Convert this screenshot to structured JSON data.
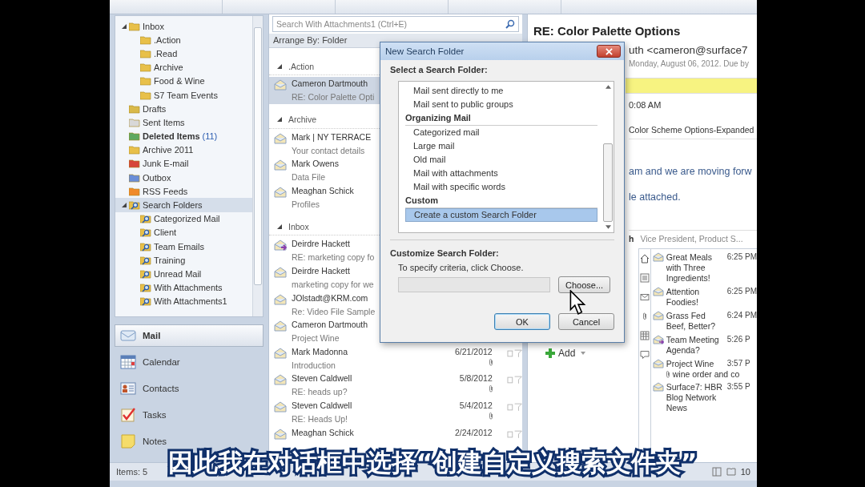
{
  "nav": {
    "folders": [
      {
        "label": "Inbox",
        "kind": "inbox",
        "selected": false,
        "expanded": true,
        "children": [
          {
            "label": ".Action",
            "kind": "folder",
            "selected": false
          },
          {
            "label": ".Read",
            "kind": "folder",
            "selected": false
          },
          {
            "label": "Archive",
            "kind": "folder",
            "selected": false
          },
          {
            "label": "Food & Wine",
            "kind": "folder",
            "selected": false
          },
          {
            "label": "S7 Team Events",
            "kind": "folder",
            "selected": false
          }
        ]
      },
      {
        "label": "Drafts",
        "kind": "drafts",
        "selected": false
      },
      {
        "label": "Sent Items",
        "kind": "sent",
        "selected": false
      },
      {
        "label": "Deleted Items",
        "count": "(11)",
        "kind": "deleted",
        "selected": false
      },
      {
        "label": "Archive 2011",
        "kind": "folder",
        "selected": false
      },
      {
        "label": "Junk E-mail",
        "kind": "junk",
        "selected": false
      },
      {
        "label": "Outbox",
        "kind": "outbox",
        "selected": false
      },
      {
        "label": "RSS Feeds",
        "kind": "rss",
        "selected": false
      },
      {
        "label": "Search Folders",
        "kind": "search",
        "selected": true,
        "expanded": true,
        "children": [
          {
            "label": "Categorized Mail",
            "kind": "search",
            "selected": false
          },
          {
            "label": "Client",
            "kind": "search",
            "selected": false
          },
          {
            "label": "Team Emails",
            "kind": "search",
            "selected": false
          },
          {
            "label": "Training",
            "kind": "search",
            "selected": false
          },
          {
            "label": "Unread Mail",
            "kind": "search",
            "selected": false
          },
          {
            "label": "With Attachments",
            "kind": "search",
            "selected": false
          },
          {
            "label": "With Attachments1",
            "kind": "search",
            "selected": false
          }
        ]
      }
    ],
    "buttons": [
      {
        "label": "Mail",
        "kind": "mail",
        "selected": true
      },
      {
        "label": "Calendar",
        "kind": "calendar",
        "selected": false
      },
      {
        "label": "Contacts",
        "kind": "contacts",
        "selected": false
      },
      {
        "label": "Tasks",
        "kind": "tasks",
        "selected": false
      },
      {
        "label": "Notes",
        "kind": "notes",
        "selected": false
      }
    ]
  },
  "list": {
    "search": {
      "placeholder": "Search With Attachments1 (Ctrl+E)"
    },
    "arrange": "Arrange By: Folder",
    "groups": [
      {
        "title": ".Action",
        "expanded": true,
        "messages": [
          {
            "sender": "Cameron Dartmouth",
            "subject": "RE: Color Palette Opti",
            "kind": "read",
            "selected": true
          }
        ]
      },
      {
        "title": "Archive",
        "expanded": true,
        "messages": [
          {
            "sender": "Mark | NY TERRACE",
            "subject": "Your contact details",
            "kind": "read",
            "selected": false
          },
          {
            "sender": "Mark Owens",
            "subject": "Data File",
            "kind": "read",
            "selected": false
          },
          {
            "sender": "Meaghan Schick",
            "subject": "Profiles",
            "kind": "read",
            "selected": false
          }
        ]
      },
      {
        "title": "Inbox",
        "expanded": true,
        "messages": [
          {
            "sender": "Deirdre Hackett",
            "subject": "RE: marketing copy fo",
            "kind": "forwarded",
            "selected": false
          },
          {
            "sender": "Deirdre Hackett",
            "subject": "marketing copy for we",
            "kind": "read",
            "selected": false
          },
          {
            "sender": "JOlstadt@KRM.com",
            "subject": "Re: Video File Sample",
            "kind": "read",
            "selected": false
          },
          {
            "sender": "Cameron Dartmouth",
            "subject": "Project Wine",
            "kind": "read",
            "selected": false
          },
          {
            "sender": "Mark Madonna",
            "subject": "Introduction",
            "date": "6/21/2012",
            "attachment": true,
            "kind": "read",
            "selected": false
          },
          {
            "sender": "Steven Caldwell",
            "subject": "RE: heads up?",
            "date": "5/8/2012",
            "attachment": true,
            "kind": "read",
            "selected": false
          },
          {
            "sender": "Steven Caldwell",
            "subject": "RE: Heads Up!",
            "date": "5/4/2012",
            "attachment": true,
            "kind": "read",
            "selected": false
          },
          {
            "sender": "Meaghan Schick",
            "date": "2/24/2012",
            "attachment": false,
            "kind": "read",
            "selected": false
          }
        ]
      }
    ]
  },
  "reading": {
    "title": "RE: Color Palette Options",
    "from": "uth <cameron@surface7",
    "sent": "Monday, August 06, 2012. Due by",
    "time": "0:08 AM",
    "attachment": "Color Scheme Options-Expanded",
    "body": [
      "am and we are moving forw",
      "le attached."
    ],
    "person": {
      "name": "h",
      "role": "Vice President, Product S..."
    },
    "add": "Add",
    "feed": [
      {
        "title": "Great Meals with Three Ingredients!",
        "time": "6:25 PM",
        "kind": "post"
      },
      {
        "title": "Attention Foodies!",
        "time": "6:25 PM",
        "kind": "post"
      },
      {
        "title": "Grass Fed Beef, Better?",
        "time": "6:24 PM",
        "kind": "post"
      },
      {
        "title": "Team Meeting Agenda?",
        "time": "5:26 P",
        "kind": "forwarded"
      },
      {
        "title": "Project Wine",
        "time": "3:57 P",
        "kind": "post",
        "note": "wine order and co"
      },
      {
        "title": "Surface7: HBR Blog Network News",
        "time": "3:55 P",
        "kind": "post"
      }
    ]
  },
  "dialog": {
    "title": "New Search Folder",
    "select_label": "Select a Search Folder:",
    "items": [
      {
        "label": "Mail sent directly to me",
        "kind": "item",
        "selected": false
      },
      {
        "label": "Mail sent to public groups",
        "kind": "item",
        "selected": false
      },
      {
        "label": "Organizing Mail",
        "kind": "header"
      },
      {
        "label": "Categorized mail",
        "kind": "item",
        "selected": false
      },
      {
        "label": "Large mail",
        "kind": "item",
        "selected": false
      },
      {
        "label": "Old mail",
        "kind": "item",
        "selected": false
      },
      {
        "label": "Mail with attachments",
        "kind": "item",
        "selected": false
      },
      {
        "label": "Mail with specific words",
        "kind": "item",
        "selected": false
      },
      {
        "label": "Custom",
        "kind": "header"
      },
      {
        "label": "Create a custom Search Folder",
        "kind": "item",
        "selected": true
      }
    ],
    "customize_label": "Customize Search Folder:",
    "hint": "To specify criteria, click Choose.",
    "choose": "Choose...",
    "buttons": [
      {
        "label": "OK",
        "default": true
      },
      {
        "label": "Cancel",
        "default": false
      }
    ]
  },
  "status": {
    "items": "Items: 5",
    "zoom": "10"
  },
  "subtitle": "因此我在对话框中选择“创建自定义搜索文件夹”"
}
